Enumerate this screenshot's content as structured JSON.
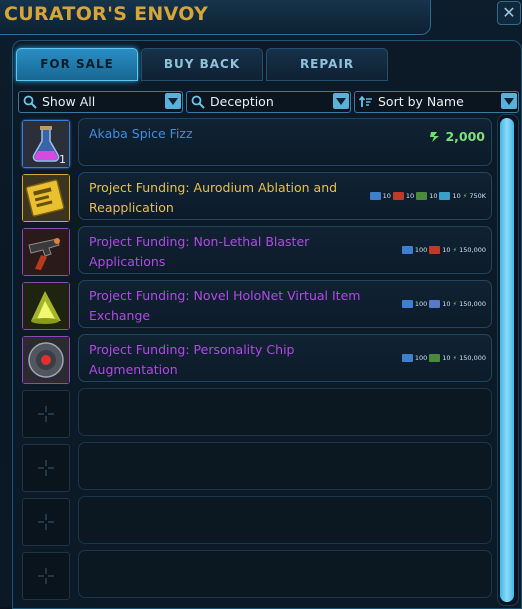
{
  "window": {
    "title": "CURATOR'S ENVOY",
    "close_label": "✕"
  },
  "tabs": [
    {
      "label": "FOR SALE",
      "active": true
    },
    {
      "label": "BUY BACK",
      "active": false
    },
    {
      "label": "REPAIR",
      "active": false
    }
  ],
  "filters": {
    "show": "Show All",
    "faction": "Deception",
    "sort": "Sort by Name"
  },
  "items": [
    {
      "name_line1": "Akaba Spice Fizz",
      "name_line2": "",
      "qty": "1",
      "price": "2,000",
      "color": "#3f8ee0",
      "quality": "q-green"
    },
    {
      "name_line1": "Project Funding: Aurodium Ablation and",
      "name_line2": "Reapplication",
      "color": "#e7c14a",
      "quality": "q-gold",
      "costs": [
        "10",
        "10",
        "10",
        "10",
        "750K"
      ]
    },
    {
      "name_line1": "Project Funding: Non-Lethal Blaster",
      "name_line2": "Applications",
      "color": "#b14ae6",
      "quality": "q-purple",
      "costs": [
        "100",
        "10",
        "150,000"
      ]
    },
    {
      "name_line1": "Project Funding: Novel HoloNet Virtual Item",
      "name_line2": "Exchange",
      "color": "#b14ae6",
      "quality": "q-purple",
      "costs": [
        "100",
        "10",
        "150,000"
      ]
    },
    {
      "name_line1": "Project Funding: Personality Chip",
      "name_line2": "Augmentation",
      "color": "#b14ae6",
      "quality": "q-purple",
      "costs": [
        "100",
        "10",
        "150,000"
      ]
    }
  ],
  "colors": {
    "accent": "#3fb7ea",
    "title": "#d6a53a",
    "credits": "#7be07a"
  }
}
